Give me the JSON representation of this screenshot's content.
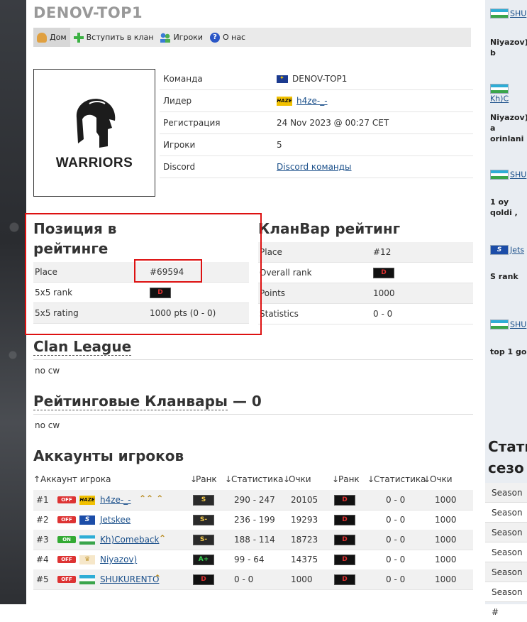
{
  "clan": {
    "title": "DENOV-TOP1",
    "logo_text": "WARRIORS"
  },
  "nav": [
    {
      "label": "Дом",
      "icon": "home-icon"
    },
    {
      "label": "Вступить в клан",
      "icon": "plus-icon"
    },
    {
      "label": "Игроки",
      "icon": "users-icon"
    },
    {
      "label": "О нас",
      "icon": "info-icon"
    }
  ],
  "info": {
    "team_label": "Команда",
    "team_value": "DENOV-TOP1",
    "leader_label": "Лидер",
    "leader_value": "h4ze-_-",
    "reg_label": "Регистрация",
    "reg_value": "24 Nov 2023 @ 00:27 CET",
    "players_label": "Игроки",
    "players_value": "5",
    "discord_label": "Discord",
    "discord_value": "Discord команды"
  },
  "position": {
    "title": "Позиция в рейтинге",
    "rows": [
      {
        "label": "Place",
        "value": "#69594"
      },
      {
        "label": "5x5 rank",
        "badge": "D"
      },
      {
        "label": "5x5 rating",
        "value": "1000 pts (0 - 0)"
      }
    ]
  },
  "clanwar": {
    "title": "КланВар рейтинг",
    "rows": [
      {
        "label": "Place",
        "value": "#12"
      },
      {
        "label": "Overall rank",
        "badge": "D"
      },
      {
        "label": "Points",
        "value": "1000"
      },
      {
        "label": "Statistics",
        "value": "0 - 0"
      }
    ]
  },
  "league": {
    "title": "Clan League",
    "empty": "no cw"
  },
  "rated": {
    "title_link": "Рейтинговые Кланвары",
    "title_count": " — 0",
    "empty": "no cw"
  },
  "accounts": {
    "title": "Аккаунты игроков",
    "headers": {
      "account": "Аккаунт игрока",
      "rank1": "Ранк",
      "stats1": "Статистика",
      "points1": "Очки",
      "rank2": "Ранк",
      "stats2": "Статистика",
      "points2": "Очки"
    },
    "rows": [
      {
        "num": "#1",
        "status": "OFF",
        "flag": "haze",
        "name": "h4ze-_-",
        "chevrons": "⌃⌃ ⌃",
        "rank1": "S",
        "stats1": "290 - 247",
        "points1": "20105",
        "rank2": "D",
        "stats2": "0 - 0",
        "points2": "1000"
      },
      {
        "num": "#2",
        "status": "OFF",
        "flag": "s5",
        "name": "Jetskee",
        "chevrons": "",
        "rank1": "S-",
        "stats1": "236 - 199",
        "points1": "19293",
        "rank2": "D",
        "stats2": "0 - 0",
        "points2": "1000"
      },
      {
        "num": "#3",
        "status": "ON",
        "flag": "uz",
        "name": "Kh)Comeback",
        "chevrons": "⌃",
        "rank1": "S-",
        "stats1": "188 - 114",
        "points1": "18723",
        "rank2": "D",
        "stats2": "0 - 0",
        "points2": "1000"
      },
      {
        "num": "#4",
        "status": "OFF",
        "flag": "cup",
        "name": "Niyazov)",
        "chevrons": "",
        "rank1": "A+",
        "stats1": "99 - 64",
        "points1": "14375",
        "rank2": "D",
        "stats2": "0 - 0",
        "points2": "1000"
      },
      {
        "num": "#5",
        "status": "OFF",
        "flag": "uz",
        "name": "SHUKURENTO",
        "chevrons": "⌃",
        "rank1": "D",
        "stats1": "0 - 0",
        "points1": "1000",
        "rank2": "D",
        "stats2": "0 - 0",
        "points2": "1000"
      }
    ]
  },
  "sidebar": {
    "items": [
      {
        "link": "SHU",
        "text": "Niyazov) b"
      },
      {
        "link": "Kh)C",
        "text": "Niyazov) a orinlani"
      },
      {
        "link": "SHU",
        "text": "1 oy qoldi ,"
      },
      {
        "link": "Jets",
        "text": "S rank"
      },
      {
        "link": "SHU",
        "text": "top 1 go"
      }
    ],
    "stats_title_1": "Стати",
    "stats_title_2": "сезо",
    "seasons": [
      "Season #",
      "Season #",
      "Season #",
      "Season #",
      "Season #",
      "Season #"
    ]
  },
  "colors": {
    "accent_red": "#dd1111",
    "link": "#1a4f8a",
    "rank_d": "#e03030"
  }
}
